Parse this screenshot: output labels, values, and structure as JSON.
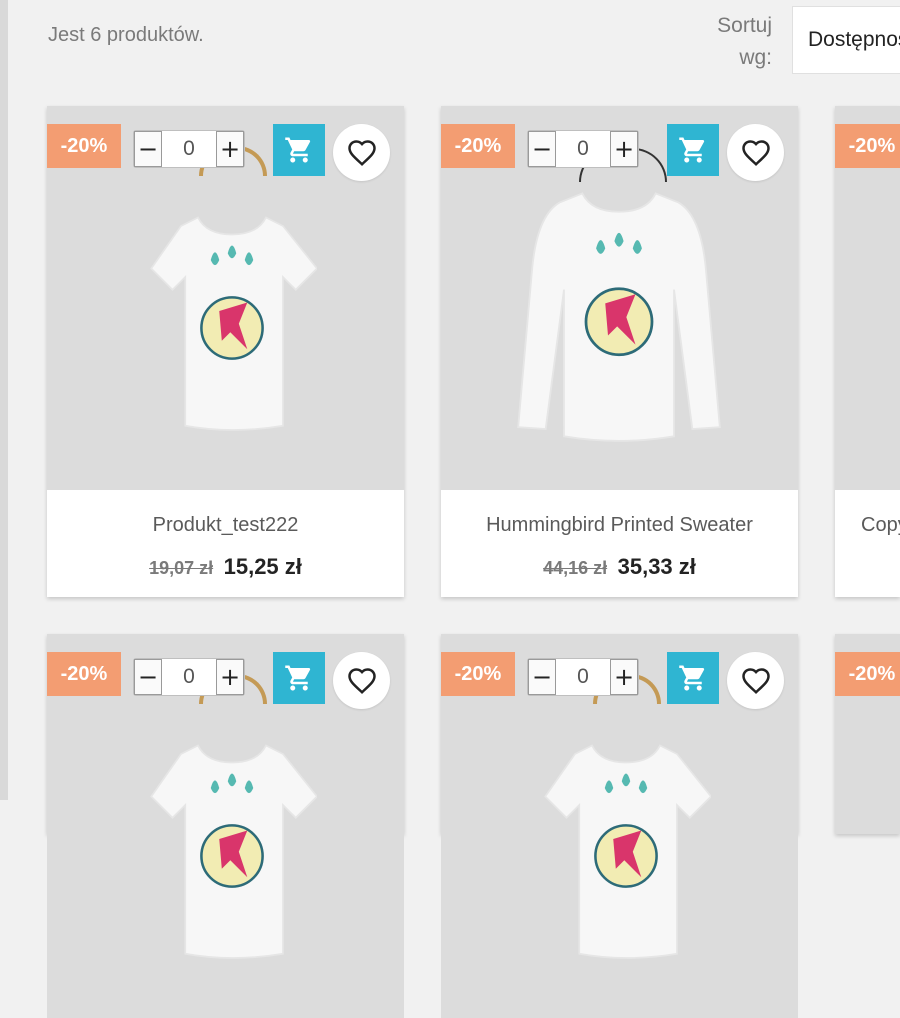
{
  "listing": {
    "count_text": "Jest 6 produktów.",
    "sort_label": "Sortuj wg:",
    "sort_value": "Dostępność"
  },
  "products": [
    {
      "discount": "-20%",
      "qty": "0",
      "qty_minus": "−",
      "qty_plus": "+",
      "name": "Produkt_test222",
      "old_price": "19,07 zł",
      "price": "15,25 zł",
      "image": "tshirt-short-sleeve"
    },
    {
      "discount": "-20%",
      "qty": "0",
      "qty_minus": "−",
      "qty_plus": "+",
      "name": "Hummingbird Printed Sweater",
      "old_price": "44,16 zł",
      "price": "35,33 zł",
      "image": "sweater-long-sleeve"
    },
    {
      "discount": "-20%",
      "name": "Copy",
      "image": "tshirt-short-sleeve"
    },
    {
      "discount": "-20%",
      "qty": "0",
      "qty_minus": "−",
      "qty_plus": "+",
      "image": "tshirt-short-sleeve"
    },
    {
      "discount": "-20%",
      "qty": "0",
      "qty_minus": "−",
      "qty_plus": "+",
      "image": "tshirt-short-sleeve"
    },
    {
      "discount": "-20%",
      "image": "tshirt-short-sleeve"
    }
  ],
  "icons": {
    "cart": "cart-icon",
    "wishlist": "heart-icon"
  },
  "colors": {
    "badge": "#f39d72",
    "cart_button": "#2fb5d2",
    "thumb_bg": "#dcdcdc"
  }
}
